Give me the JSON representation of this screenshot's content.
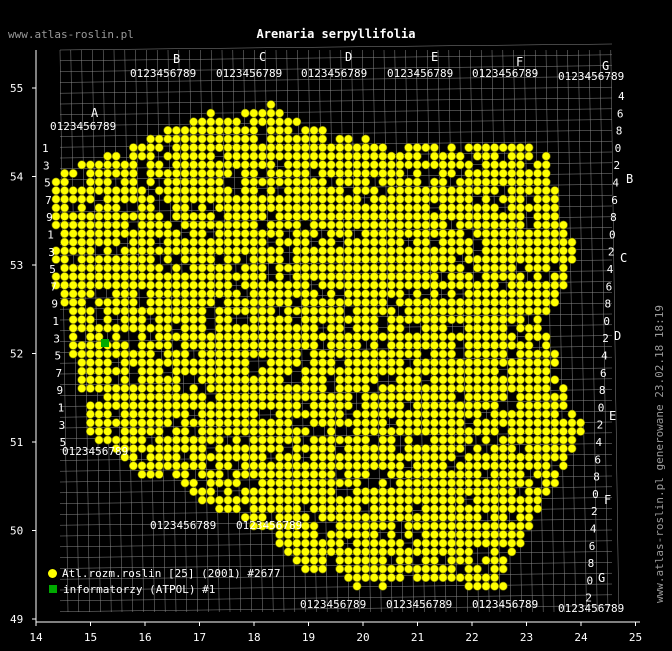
{
  "header": {
    "title": "Arenaria serpyllifolia",
    "site_label": "www.atlas-roslin.pl",
    "side_note": "www.atlas-roslin.pl generowane 23.02.18 18:19"
  },
  "axes": {
    "x_ticks": [
      "14",
      "15",
      "16",
      "17",
      "18",
      "19",
      "20",
      "21",
      "22",
      "23",
      "24",
      "25"
    ],
    "y_ticks": [
      "55",
      "54",
      "53",
      "52",
      "51",
      "50",
      "49"
    ]
  },
  "atpol": {
    "column_letters": [
      "A",
      "B",
      "C",
      "D",
      "E",
      "F",
      "G"
    ],
    "row_letters": [
      "A",
      "B",
      "C",
      "D",
      "E",
      "F",
      "G"
    ],
    "subdivision_digits": "0123456789",
    "row_side_digits": [
      "1",
      "3",
      "5",
      "7",
      "9"
    ],
    "right_side_digits": [
      "4",
      "6",
      "8",
      "0",
      "2"
    ]
  },
  "legend": [
    {
      "label": "Atl.rozm.roslin [25] (2001) #2677",
      "color": "#ffff00",
      "shape": "circle"
    },
    {
      "label": "informatorzy (ATPOL) #1",
      "color": "#00aa00",
      "shape": "square"
    }
  ],
  "colors": {
    "background": "#000000",
    "grid": "#8a8a8a",
    "axis": "#ffffff",
    "dot_fill": "#ffff00",
    "dot_stroke": "#7a7a00",
    "informator": "#00aa00"
  }
}
